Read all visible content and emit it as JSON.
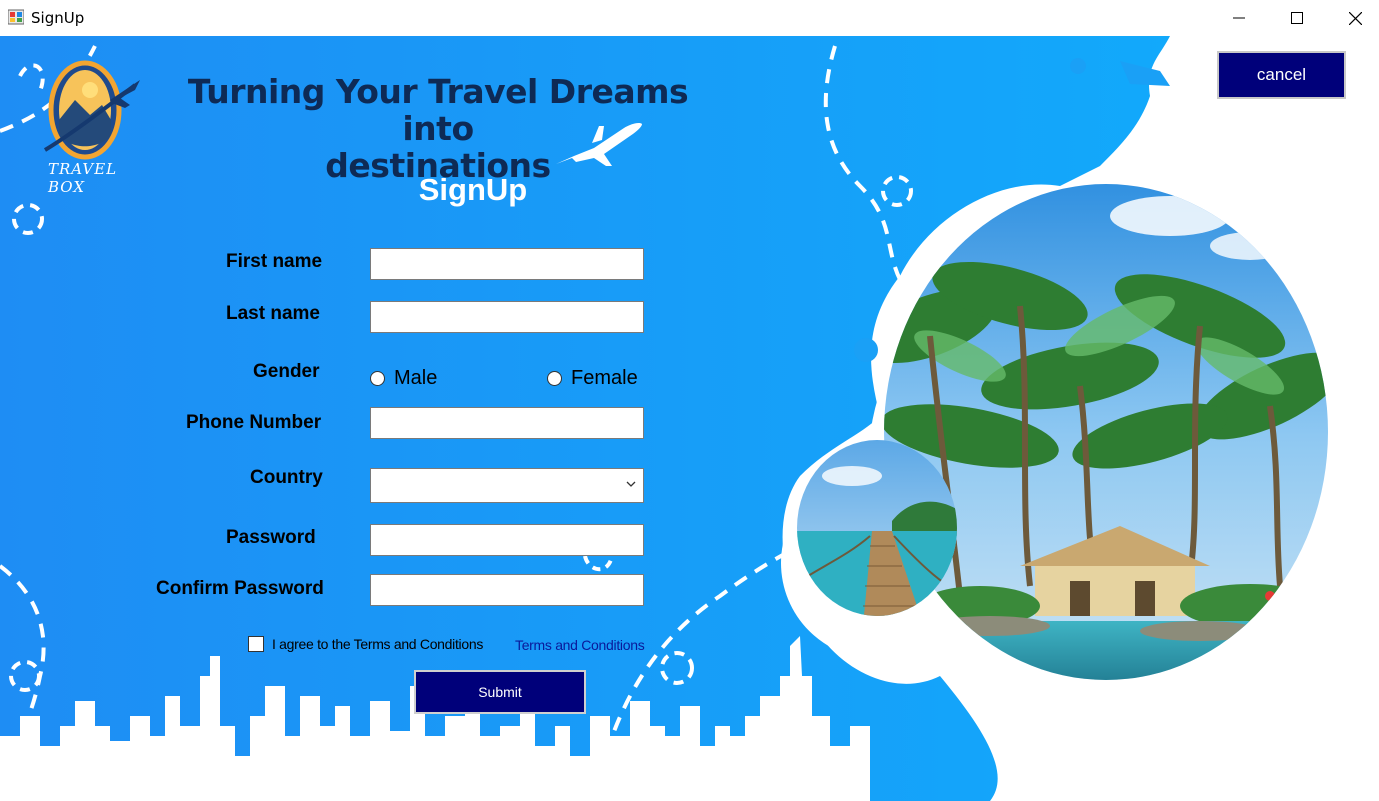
{
  "window": {
    "title": "SignUp"
  },
  "header": {
    "logo_text": "TRAVEL BOX",
    "headline_line1": "Turning Your Travel Dreams into",
    "headline_line2": "destinations"
  },
  "form": {
    "title": "SignUp",
    "first_name_label": "First name",
    "first_name_value": "",
    "last_name_label": "Last name",
    "last_name_value": "",
    "gender_label": "Gender",
    "gender_options": [
      "Male",
      "Female"
    ],
    "phone_label": "Phone Number",
    "phone_value": "",
    "country_label": "Country",
    "country_value": "",
    "password_label": "Password",
    "password_value": "",
    "confirm_password_label": "Confirm Password",
    "confirm_password_value": "",
    "agree_label": "I agree to the Terms and Conditions",
    "terms_link": "Terms and Conditions",
    "submit_label": "Submit"
  },
  "toolbar": {
    "cancel_label": "cancel"
  },
  "colors": {
    "background_blue": "#1aa0f6",
    "button_navy": "#00007a",
    "headline_navy": "#0e2a55",
    "link_blue": "#0a1a9a"
  }
}
